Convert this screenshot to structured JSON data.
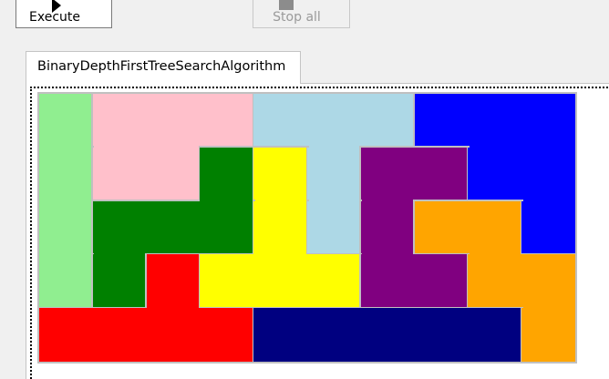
{
  "toolbar": {
    "execute_label": "Execute",
    "stop_label": "Stop all"
  },
  "tab": {
    "label": "BinaryDepthFirstTreeSearchAlgorithm"
  },
  "board": {
    "columns": 10,
    "rows": 5,
    "grid": [
      [
        "lightgreen",
        "pink",
        "pink",
        "pink",
        "lightblue",
        "lightblue",
        "lightblue",
        "blue",
        "blue",
        "blue"
      ],
      [
        "lightgreen",
        "pink",
        "pink",
        "green",
        "yellow",
        "lightblue",
        "purple",
        "purple",
        "blue",
        "blue"
      ],
      [
        "lightgreen",
        "green",
        "green",
        "green",
        "yellow",
        "lightblue",
        "purple",
        "orange",
        "orange",
        "blue"
      ],
      [
        "lightgreen",
        "green",
        "red",
        "yellow",
        "yellow",
        "yellow",
        "purple",
        "purple",
        "orange",
        "orange"
      ],
      [
        "red",
        "red",
        "red",
        "red",
        "navy",
        "navy",
        "navy",
        "navy",
        "navy",
        "orange"
      ]
    ],
    "colors": {
      "lightgreen": "#90ee90",
      "pink": "#ffc0cb",
      "lightblue": "#add8e6",
      "blue": "#0000ff",
      "green": "#008000",
      "yellow": "#ffff00",
      "purple": "#800080",
      "orange": "#ffa500",
      "red": "#ff0000",
      "navy": "#000080",
      "border": "#c0c0c0"
    }
  }
}
